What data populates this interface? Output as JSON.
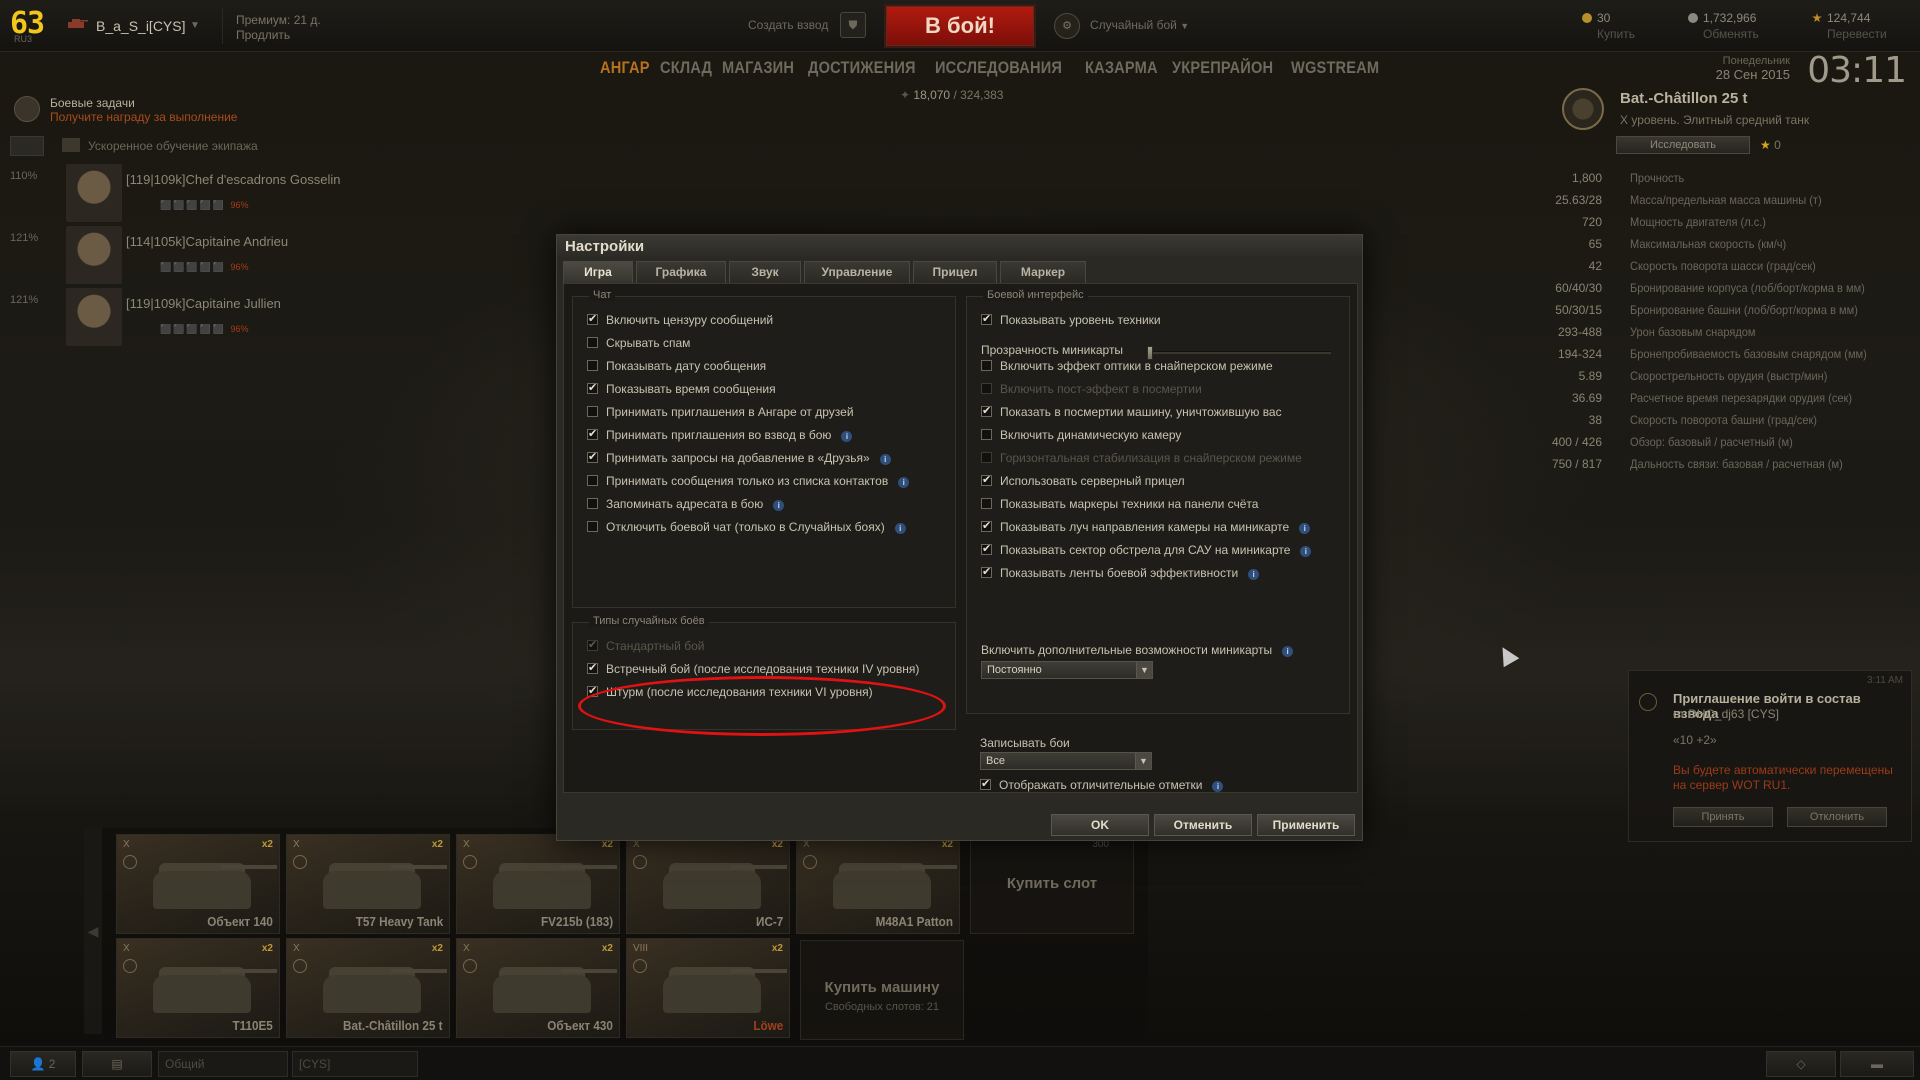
{
  "header": {
    "level": "63",
    "server": "RU3",
    "player_name": "B_a_S_i[CYS]",
    "premium_line1": "Премиум: 21 д.",
    "premium_line2": "Продлить",
    "create_platoon": "Создать взвод",
    "battle_button": "В бой!",
    "battle_mode": "Случайный бой",
    "gold": {
      "value": "30",
      "action": "Купить"
    },
    "credits": {
      "value": "1,732,966",
      "action": "Обменять"
    },
    "free_xp": {
      "value": "124,744",
      "action": "Перевести"
    }
  },
  "nav": {
    "items": [
      "АНГАР",
      "СКЛАД",
      "МАГАЗИН",
      "ДОСТИЖЕНИЯ",
      "ИССЛЕДОВАНИЯ",
      "КАЗАРМА",
      "УКРЕПРАЙОН",
      "WGSTREAM"
    ],
    "active": "АНГАР",
    "xp_current": "18,070",
    "xp_total": "/ 324,383"
  },
  "datetime": {
    "weekday": "Понедельник",
    "date": "28 Сен 2015",
    "time": "03:11"
  },
  "left_panel": {
    "tasks_title": "Боевые задачи",
    "tasks_subtitle": "Получите награду за выполнение",
    "crew_speed_label": "Ускоренное обучение экипажа",
    "crew": [
      {
        "pct": "110%",
        "name": "[119|109k]Chef d'escadrons Gosselin",
        "skill": "96%"
      },
      {
        "pct": "121%",
        "name": "[114|105k]Capitaine Andrieu",
        "skill": "96%"
      },
      {
        "pct": "121%",
        "name": "[119|109k]Capitaine Jullien",
        "skill": "96%"
      }
    ]
  },
  "tank_panel": {
    "name": "Bat.-Châtillon 25 t",
    "subtitle": "X уровень. Элитный средний танк",
    "research_button": "Исследовать",
    "stars": "0",
    "stats": [
      {
        "value": "1,800",
        "label": "Прочность"
      },
      {
        "value": "25.63/28",
        "label": "Масса/предельная масса машины (т)"
      },
      {
        "value": "720",
        "label": "Мощность двигателя (л.с.)"
      },
      {
        "value": "65",
        "label": "Максимальная скорость (км/ч)"
      },
      {
        "value": "42",
        "label": "Скорость поворота шасси (град/сек)"
      },
      {
        "value": "60/40/30",
        "label": "Бронирование корпуса (лоб/борт/корма в мм)"
      },
      {
        "value": "50/30/15",
        "label": "Бронирование башни (лоб/борт/корма в мм)"
      },
      {
        "value": "293-488",
        "label": "Урон базовым снарядом"
      },
      {
        "value": "194-324",
        "label": "Бронепробиваемость базовым снарядом (мм)"
      },
      {
        "value": "5.89",
        "label": "Скорострельность орудия (выстр/мин)"
      },
      {
        "value": "36.69",
        "label": "Расчетное время перезарядки орудия (сек)"
      },
      {
        "value": "38",
        "label": "Скорость поворота башни (град/сек)"
      },
      {
        "value": "400 / 426",
        "label": "Обзор: базовый / расчетный (м)"
      },
      {
        "value": "750 / 817",
        "label": "Дальность связи: базовая / расчетная (м)"
      }
    ]
  },
  "invite": {
    "time": "3:11 AM",
    "title": "Приглашение войти в состав взвода",
    "from": "от DHO_dj63 [CYS]",
    "mode": "«10 +2»",
    "warning": "Вы будете автоматически перемещены на сервер WOT RU1.",
    "accept": "Принять",
    "decline": "Отклонить"
  },
  "carousel": {
    "tanks_row1": [
      {
        "tier": "X",
        "name": "Объект 140",
        "red": false
      },
      {
        "tier": "X",
        "name": "T57 Heavy Tank",
        "red": false
      },
      {
        "tier": "X",
        "name": "FV215b (183)",
        "red": false
      },
      {
        "tier": "X",
        "name": "ИС-7",
        "red": false
      },
      {
        "tier": "X",
        "name": "M48A1 Patton",
        "red": false
      }
    ],
    "tanks_row2": [
      {
        "tier": "X",
        "name": "T110E5",
        "red": false
      },
      {
        "tier": "X",
        "name": "Bat.-Châtillon 25 t",
        "red": false
      },
      {
        "tier": "X",
        "name": "Объект 430",
        "red": false
      },
      {
        "tier": "VIII",
        "name": "Löwe",
        "red": true
      }
    ],
    "multiplier": "x2",
    "buy_slot": "Купить слот",
    "buy_slot_price": "300",
    "buy_tank": "Купить машину",
    "free_slots": "Свободных слотов: 21"
  },
  "bottom": {
    "friends_count": "2",
    "chat_channel": "Общий",
    "clan_channel": "[CYS]"
  },
  "settings": {
    "title": "Настройки",
    "tabs": [
      "Игра",
      "Графика",
      "Звук",
      "Управление",
      "Прицел",
      "Маркер"
    ],
    "chat_group": "Чат",
    "chat_options": [
      {
        "label": "Включить цензуру сообщений",
        "checked": true,
        "info": false
      },
      {
        "label": "Скрывать спам",
        "checked": false,
        "info": false
      },
      {
        "label": "Показывать дату сообщения",
        "checked": false,
        "info": false
      },
      {
        "label": "Показывать время сообщения",
        "checked": true,
        "info": false
      },
      {
        "label": "Принимать приглашения в Ангаре от друзей",
        "checked": false,
        "info": false
      },
      {
        "label": "Принимать приглашения во взвод в бою",
        "checked": true,
        "info": true
      },
      {
        "label": "Принимать запросы на добавление в «Друзья»",
        "checked": true,
        "info": true
      },
      {
        "label": "Принимать сообщения только из списка контактов",
        "checked": false,
        "info": true
      },
      {
        "label": "Запоминать адресата в бою",
        "checked": false,
        "info": true
      },
      {
        "label": "Отключить боевой чат (только в Случайных боях)",
        "checked": false,
        "info": true
      }
    ],
    "battle_types_group": "Типы случайных боёв",
    "battle_types": [
      {
        "label": "Стандартный бой",
        "checked": true,
        "disabled": true
      },
      {
        "label": "Встречный бой (после исследования техники IV уровня)",
        "checked": true,
        "disabled": false
      },
      {
        "label": "Штурм (после исследования техники VI уровня)",
        "checked": true,
        "disabled": false
      }
    ],
    "interface_group": "Боевой интерфейс",
    "interface_options": [
      {
        "label": "Показывать уровень техники",
        "checked": true,
        "disabled": false,
        "info": false
      },
      {
        "label": "Включить эффект оптики в снайперском режиме",
        "checked": false,
        "disabled": false,
        "info": false
      },
      {
        "label": "Включить пост-эффект в посмертии",
        "checked": false,
        "disabled": true,
        "info": false
      },
      {
        "label": "Показать в посмертии машину, уничтожившую вас",
        "checked": true,
        "disabled": false,
        "info": false
      },
      {
        "label": "Включить динамическую камеру",
        "checked": false,
        "disabled": false,
        "info": false
      },
      {
        "label": "Горизонтальная стабилизация в снайперском режиме",
        "checked": false,
        "disabled": true,
        "info": false
      },
      {
        "label": "Использовать серверный прицел",
        "checked": true,
        "disabled": false,
        "info": false
      },
      {
        "label": "Показывать маркеры техники на панели счёта",
        "checked": false,
        "disabled": false,
        "info": false
      },
      {
        "label": "Показывать луч направления камеры на миникарте",
        "checked": true,
        "disabled": false,
        "info": true
      },
      {
        "label": "Показывать сектор обстрела для САУ на миникарте",
        "checked": true,
        "disabled": false,
        "info": true
      },
      {
        "label": "Показывать ленты боевой эффективности",
        "checked": true,
        "disabled": false,
        "info": true
      }
    ],
    "minimap_transparency_label": "Прозрачность миникарты",
    "minimap_transparency_value": 0,
    "minimap_extra_label": "Включить дополнительные возможности миникарты",
    "minimap_extra_value": "Постоянно",
    "record_label": "Записывать бои",
    "record_value": "Все",
    "marks_label": "Отображать отличительные отметки",
    "marks_checked": true,
    "ok": "OK",
    "cancel": "Отменить",
    "apply": "Применить"
  }
}
